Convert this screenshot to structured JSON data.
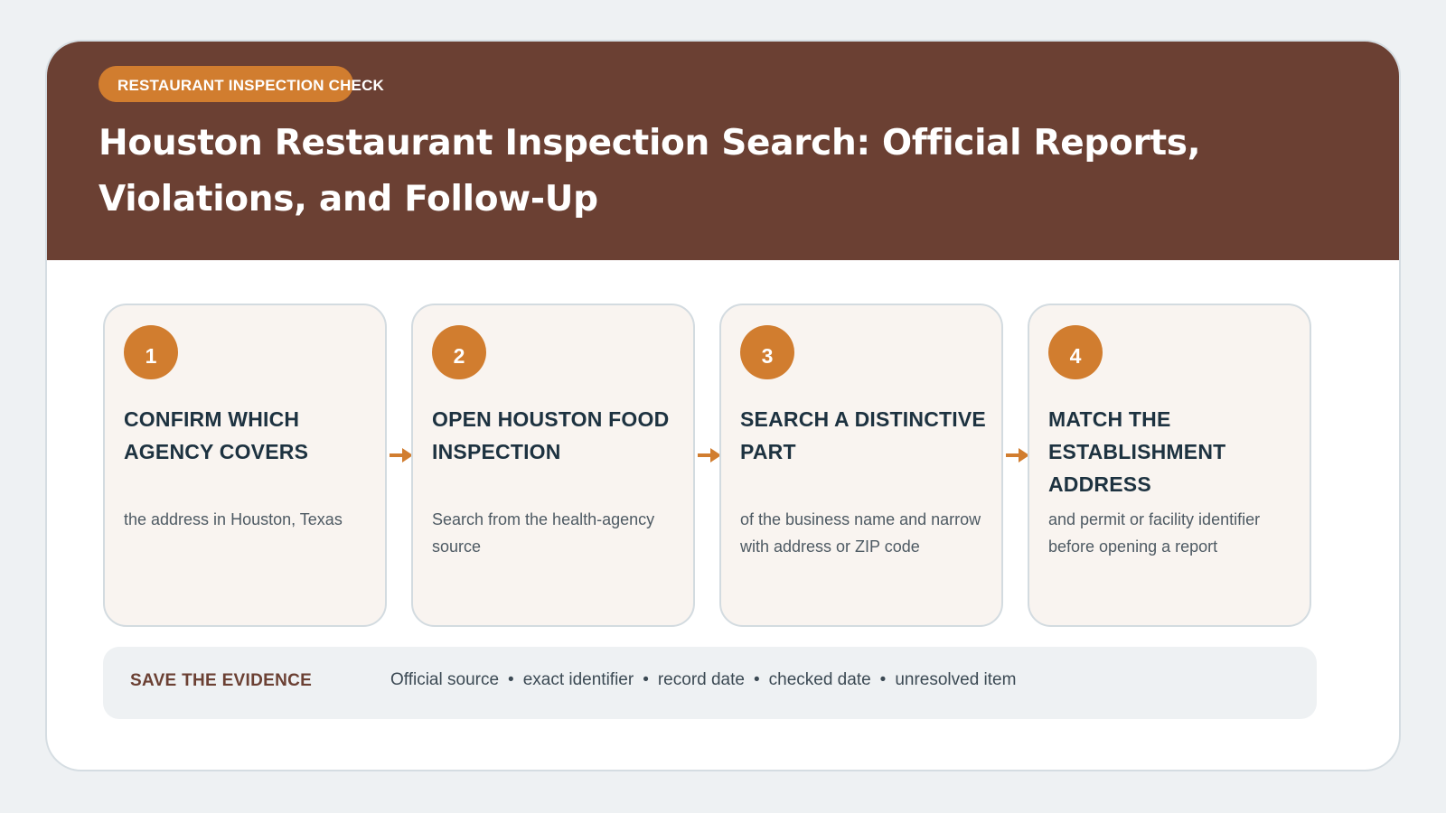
{
  "header": {
    "kicker": "RESTAURANT INSPECTION CHECK",
    "title": "Houston Restaurant Inspection Search: Official Reports, Violations, and Follow-Up"
  },
  "steps": [
    {
      "number": "1",
      "title": "CONFIRM WHICH AGENCY COVERS",
      "description": "the address in Houston, Texas"
    },
    {
      "number": "2",
      "title": "OPEN HOUSTON FOOD INSPECTION",
      "description": "Search from the health-agency source"
    },
    {
      "number": "3",
      "title": "SEARCH A DISTINCTIVE PART",
      "description": "of the business name and narrow with address or ZIP code"
    },
    {
      "number": "4",
      "title": "MATCH THE ESTABLISHMENT ADDRESS",
      "description": "and permit or facility identifier before opening a report"
    }
  ],
  "evidence": {
    "title": "SAVE THE EVIDENCE",
    "items": [
      "Official source",
      "exact identifier",
      "record date",
      "checked date",
      "unresolved item"
    ],
    "separator": "•"
  },
  "colors": {
    "header_bg": "#6b4033",
    "accent": "#d17d2f",
    "heading_text": "#1d3240",
    "card_bg": "#f9f4f0",
    "page_bg": "#eef1f3"
  }
}
